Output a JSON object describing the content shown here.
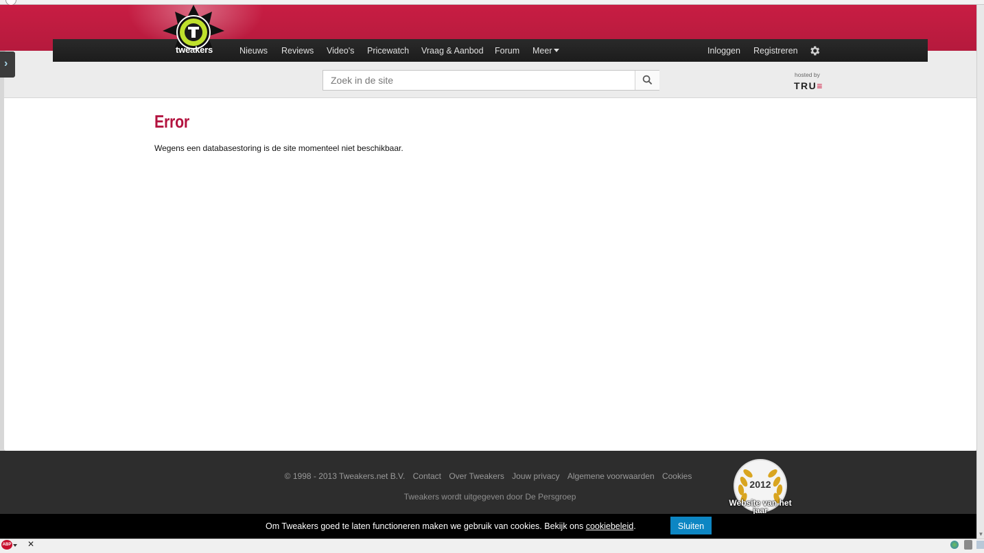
{
  "nav": {
    "logo_text": "tweakers",
    "items": [
      "Nieuws",
      "Reviews",
      "Video's",
      "Pricewatch",
      "Vraag & Aanbod",
      "Forum"
    ],
    "more_label": "Meer",
    "login_label": "Inloggen",
    "register_label": "Registreren"
  },
  "search": {
    "placeholder": "Zoek in de site"
  },
  "hosting": {
    "label": "hosted by",
    "brand": "TRU",
    "brand_e": "≡"
  },
  "content": {
    "title": "Error",
    "message": "Wegens een databasestoring is de site momenteel niet beschikbaar."
  },
  "footer": {
    "copyright": "© 1998 - 2013 Tweakers.net B.V.",
    "links": [
      "Contact",
      "Over Tweakers",
      "Jouw privacy",
      "Algemene voorwaarden",
      "Cookies"
    ],
    "publisher": "Tweakers wordt uitgegeven door De Persgroep",
    "award_year": "2012",
    "award_text": "Website van het jaar"
  },
  "cookie": {
    "text": "Om Tweakers goed te laten functioneren maken we gebruik van cookies. Bekijk ons ",
    "link": "cookiebeleid",
    "after": ".",
    "button": "Sluiten"
  },
  "statusbar": {
    "addon_badge": "ABP",
    "close": "✕"
  },
  "colors": {
    "brand_red": "#c81d43",
    "title_red": "#b3133f",
    "button_blue": "#0d86c3"
  }
}
